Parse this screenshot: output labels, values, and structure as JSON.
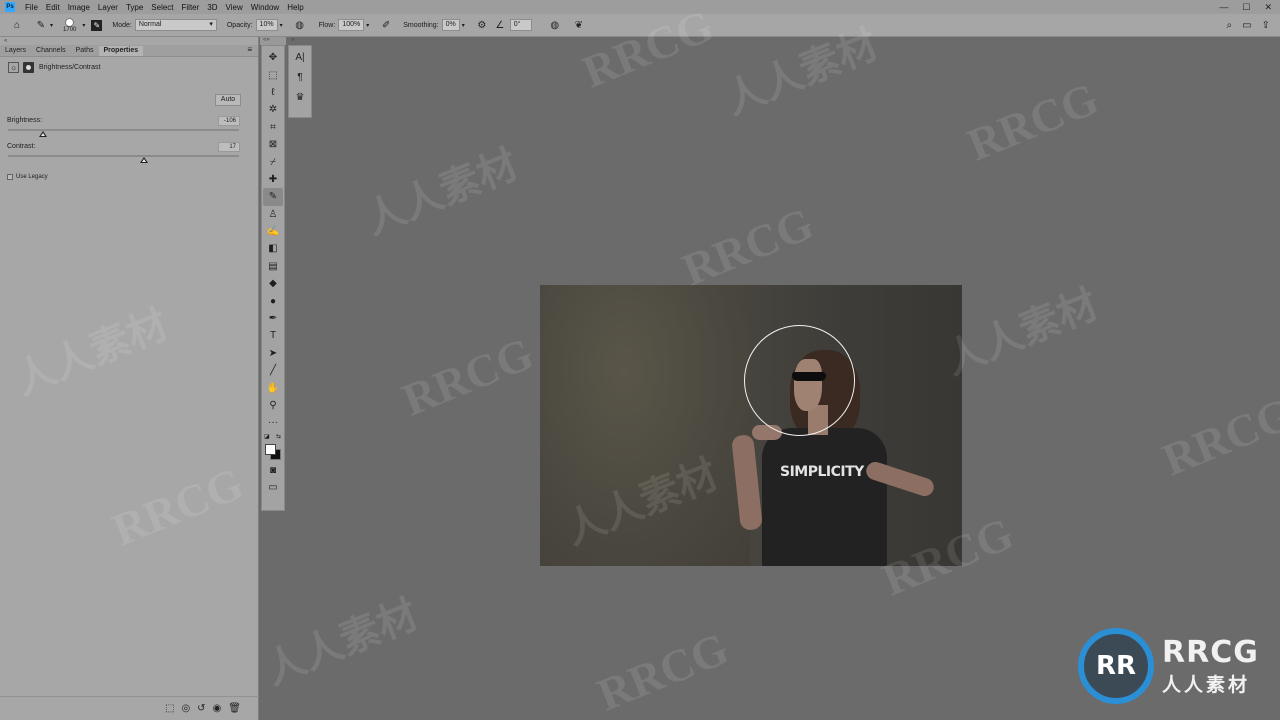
{
  "menu": {
    "items": [
      "File",
      "Edit",
      "Image",
      "Layer",
      "Type",
      "Select",
      "Filter",
      "3D",
      "View",
      "Window",
      "Help"
    ],
    "window_controls": [
      "—",
      "☐",
      "✕"
    ]
  },
  "options": {
    "brush_size": "1700",
    "mode_label": "Mode:",
    "mode_value": "Normal",
    "opacity_label": "Opacity:",
    "opacity_value": "10%",
    "flow_label": "Flow:",
    "flow_value": "100%",
    "smoothing_label": "Smoothing:",
    "smoothing_value": "0%",
    "angle_value": "0°"
  },
  "properties": {
    "tabs": [
      "Layers",
      "Channels",
      "Paths",
      "Properties"
    ],
    "active_tab": "Properties",
    "adjustment_title": "Brightness/Contrast",
    "auto_label": "Auto",
    "brightness_label": "Brightness:",
    "brightness_value": "-106",
    "brightness_fraction": 0.15,
    "contrast_label": "Contrast:",
    "contrast_value": "17",
    "contrast_fraction": 0.59,
    "legacy_label": "Use Legacy"
  },
  "canvas": {
    "shirt_text": "SIMPLICITY"
  },
  "watermark": {
    "latin": "RRCG",
    "cjk": "人人素材"
  },
  "logo": {
    "mark": "RR",
    "title": "RRCG",
    "subtitle": "人人素材"
  },
  "colors": {
    "foreground": "#ffffff",
    "background": "#111111",
    "logo_accent": "#2b8fd6"
  }
}
